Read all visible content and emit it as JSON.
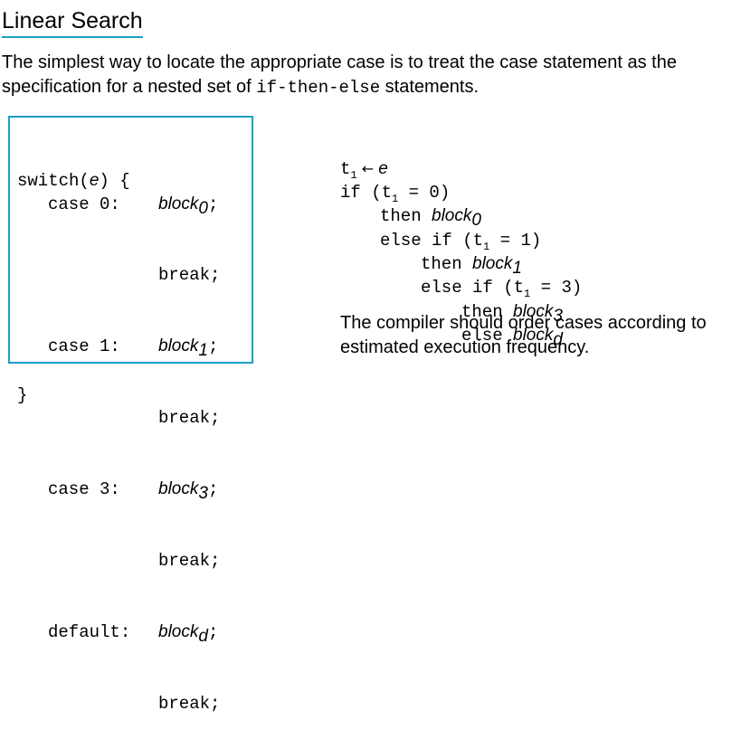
{
  "title": "Linear Search",
  "intro": {
    "before": "The simplest way to locate the appropriate case is to treat the case statement as the specification for a nested set of ",
    "code": "if-then-else",
    "after": " statements."
  },
  "switch_code": {
    "header_kw": "switch(",
    "header_var": "e",
    "header_end": ") {",
    "case0_label": "case 0:",
    "case1_label": "case 1:",
    "case3_label": "case 3:",
    "default_label": "default:",
    "block": "block",
    "sub0": "0",
    "sub1": "1",
    "sub3": "3",
    "subd": "d",
    "semicolon": ";",
    "break": "break;",
    "close": "}"
  },
  "if_code": {
    "t": "t",
    "tsub": "1",
    "arrow": " ← ",
    "e": "e",
    "if_open": "if (",
    "eq0": " = 0)",
    "then": "then ",
    "else_if_open": "else if (",
    "eq1": " = 1)",
    "eq3": " = 3)",
    "else": "else ",
    "block": "block",
    "sub0": "0",
    "sub1": "1",
    "sub3": "3",
    "subd": "d"
  },
  "note": "The compiler should order cases according to estimated execution frequency."
}
